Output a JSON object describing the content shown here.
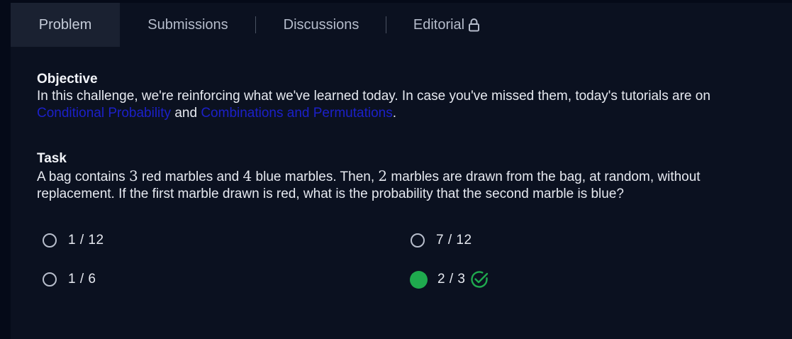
{
  "tabs": [
    {
      "label": "Problem",
      "active": true
    },
    {
      "label": "Submissions",
      "active": false
    },
    {
      "label": "Discussions",
      "active": false
    },
    {
      "label": "Editorial",
      "active": false,
      "icon": "lock-icon"
    }
  ],
  "objective": {
    "heading": "Objective",
    "text_1": "In this challenge, we're reinforcing what we've learned today. In case you've missed them, today's tutorials are on ",
    "link_1": "Conditional Probability",
    "text_2": " and ",
    "link_2": "Combinations and Permutations",
    "text_3": "."
  },
  "task": {
    "heading": "Task",
    "t1": "A bag contains ",
    "n1": "3",
    "t2": " red marbles and ",
    "n2": "4",
    "t3": " blue marbles. Then, ",
    "n3": "2",
    "t4": " marbles are drawn from the bag, at random, without replacement. If the first marble drawn is red, what is the probability that the second marble is blue?"
  },
  "options": [
    {
      "label": "1 / 12",
      "selected": false
    },
    {
      "label": "7 / 12",
      "selected": false
    },
    {
      "label": "1 / 6",
      "selected": false
    },
    {
      "label": "2 / 3",
      "selected": true,
      "correct": true
    }
  ],
  "colors": {
    "background": "#050a18",
    "panel": "#0b1120",
    "active_tab": "#1a2131",
    "link": "#1c20c8",
    "correct": "#1faa4e"
  },
  "icons": [
    "lock-icon",
    "radio-icon",
    "check-circle-icon"
  ]
}
